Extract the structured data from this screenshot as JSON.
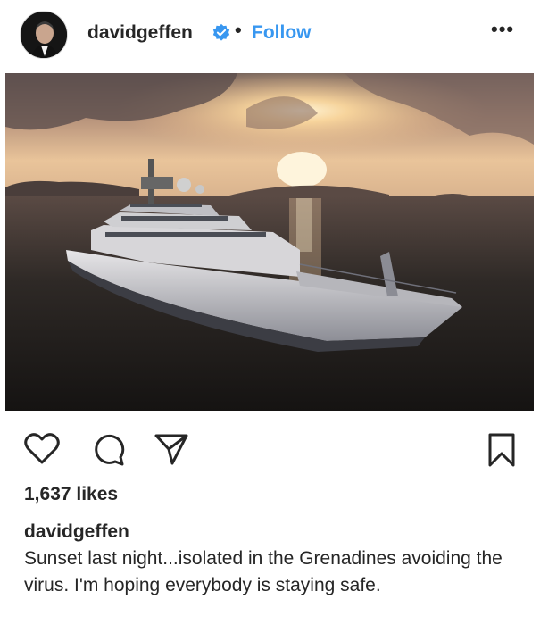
{
  "post": {
    "username": "davidgeffen",
    "separator": "•",
    "follow_label": "Follow",
    "more_icon": "more-options-icon",
    "more_glyph": "•••",
    "verified": true,
    "photo_description_icon": "yacht-sunset-photo"
  },
  "actions": {
    "like_icon": "heart-icon",
    "comment_icon": "comment-icon",
    "share_icon": "share-icon",
    "save_icon": "bookmark-icon"
  },
  "engagement": {
    "likes_text": "1,637 likes"
  },
  "caption": {
    "username": "davidgeffen",
    "text": "Sunset last night...isolated in the Grenadines avoiding the virus. I'm hoping everybody is staying safe."
  },
  "colors": {
    "link_blue": "#3897f0",
    "verified_blue": "#3897f0",
    "text": "#262626"
  }
}
